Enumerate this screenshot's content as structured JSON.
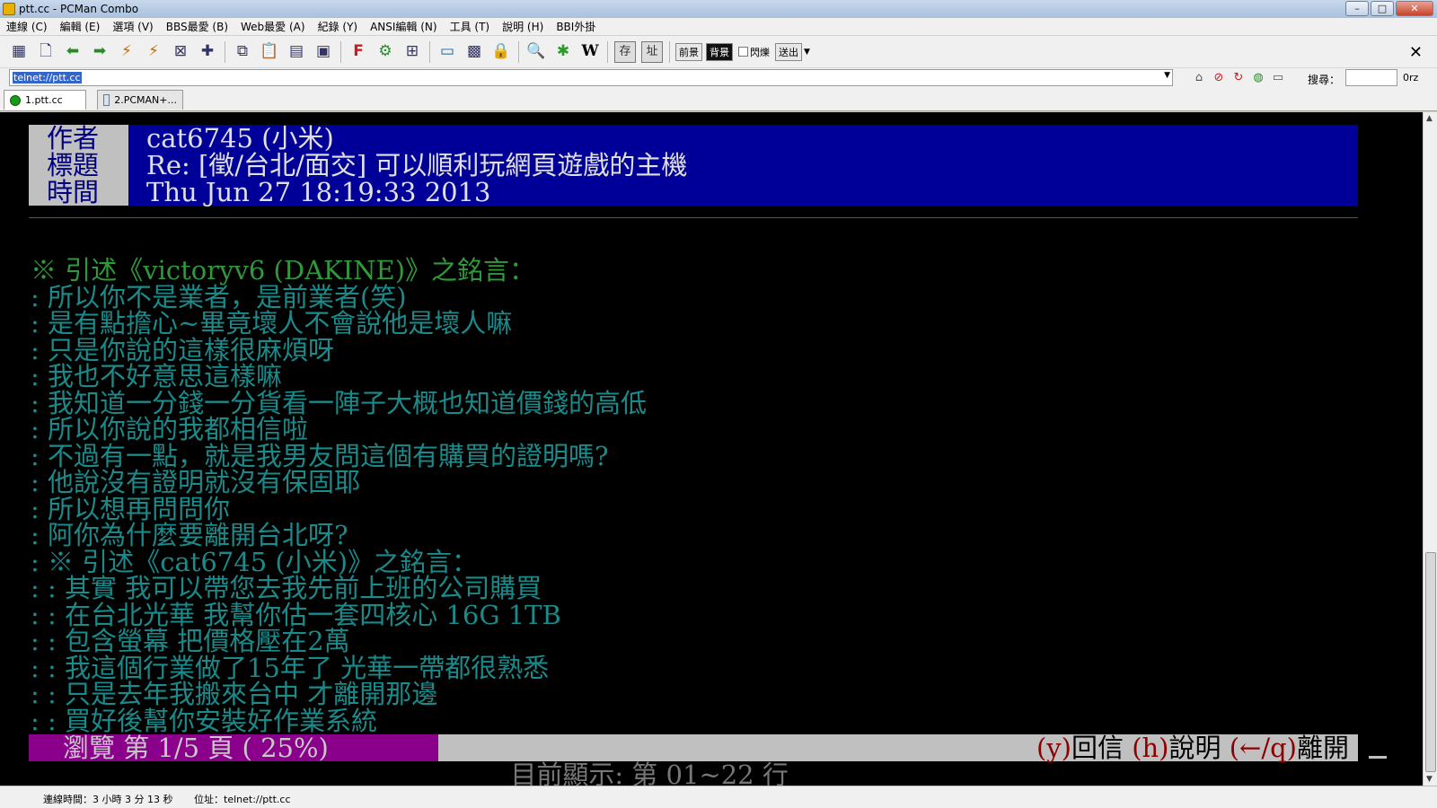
{
  "window": {
    "title": "ptt.cc - PCMan Combo",
    "controls": {
      "minimize": "–",
      "maximize": "□",
      "close": "✕"
    }
  },
  "menu": {
    "items": [
      "連線 (C)",
      "編輯 (E)",
      "選項 (V)",
      "BBS最愛 (B)",
      "Web最愛 (A)",
      "紀錄 (Y)",
      "ANSI編輯 (N)",
      "工具 (T)",
      "說明 (H)",
      "BBI外掛"
    ]
  },
  "toolbar": {
    "foreground_label": "前景",
    "background_label": "背景",
    "blink_label": "閃爍",
    "send_label": "送出",
    "close_glyph": "✕"
  },
  "address": {
    "value": "telnet://ptt.cc",
    "search_label": "搜尋：",
    "search_engine": "0rz"
  },
  "tabs": [
    {
      "label": "1.ptt.cc"
    },
    {
      "label": "2.PCMAN+..."
    }
  ],
  "terminal": {
    "header": {
      "author_label": "作者",
      "title_label": "標題",
      "time_label": "時間",
      "author_value": "cat6745 (小米)",
      "title_value": "Re: [徵/台北/面交] 可以順利玩網頁遊戲的主機",
      "time_value": "Thu Jun 27 18:19:33 2013"
    },
    "lines": [
      {
        "text": "※ 引述《victoryv6 (DAKINE)》之銘言：",
        "color": "green"
      },
      {
        "text": ": 所以你不是業者，是前業者(笑)",
        "color": "cyan"
      },
      {
        "text": ": 是有點擔心~畢竟壞人不會說他是壞人嘛",
        "color": "cyan"
      },
      {
        "text": ": 只是你說的這樣很麻煩呀",
        "color": "cyan"
      },
      {
        "text": ": 我也不好意思這樣嘛",
        "color": "cyan"
      },
      {
        "text": ": 我知道一分錢一分貨看一陣子大概也知道價錢的高低",
        "color": "cyan"
      },
      {
        "text": ": 所以你說的我都相信啦",
        "color": "cyan"
      },
      {
        "text": ": 不過有一點，就是我男友問這個有購買的證明嗎?",
        "color": "cyan"
      },
      {
        "text": ": 他說沒有證明就沒有保固耶",
        "color": "cyan"
      },
      {
        "text": ": 所以想再問問你",
        "color": "cyan"
      },
      {
        "text": ": 阿你為什麼要離開台北呀?",
        "color": "cyan"
      },
      {
        "text": ": ※ 引述《cat6745 (小米)》之銘言：",
        "color": "cyan"
      },
      {
        "text": ": : 其實 我可以帶您去我先前上班的公司購買",
        "color": "cyan"
      },
      {
        "text": ": : 在台北光華 我幫你估一套四核心 16G 1TB",
        "color": "cyan"
      },
      {
        "text": ": : 包含螢幕 把價格壓在2萬",
        "color": "cyan"
      },
      {
        "text": ": : 我這個行業做了15年了 光華一帶都很熟悉",
        "color": "cyan"
      },
      {
        "text": ": : 只是去年我搬來台中 才離開那邊",
        "color": "cyan"
      },
      {
        "text": ": : 買好後幫你安裝好作業系統",
        "color": "cyan"
      }
    ],
    "status": {
      "browse": "瀏覽 第 1/5 頁 ( 25%)",
      "showing": "目前顯示: 第 01~22 行",
      "key_y": "(y)",
      "label_y": "回信 ",
      "key_h": "(h)",
      "label_h": "說明 ",
      "key_q": "(←/q)",
      "label_q": "離開"
    }
  },
  "statusbar": {
    "connection_time": "連線時間：3 小時 3 分 13 秒",
    "address": "位址：telnet://ptt.cc"
  },
  "colors": {
    "header_label_bg": "#c0c0c0",
    "header_value_bg": "#000099",
    "quote_green": "#2e9a3a",
    "quote_cyan": "#1a8a8a",
    "status_browse_bg": "#8b008b"
  }
}
